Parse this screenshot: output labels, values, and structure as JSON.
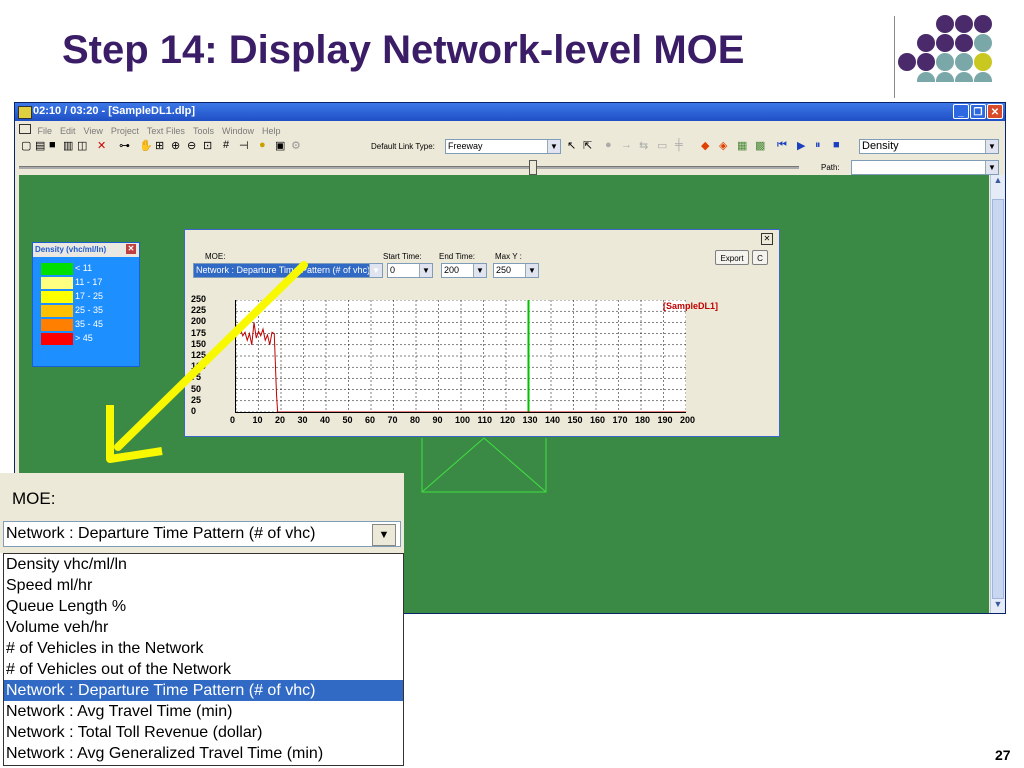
{
  "slide": {
    "title": "Step 14: Display Network-level MOE",
    "page_number": "27",
    "dot_colors": [
      "#4a2a6a",
      "#7aa7a7",
      "#c8c820"
    ]
  },
  "window": {
    "title": "02:10 / 03:20 - [SampleDL1.dlp]",
    "menu": [
      "File",
      "Edit",
      "View",
      "Project",
      "Text Files",
      "Tools",
      "Window",
      "Help"
    ],
    "link_type_label": "Default Link Type:",
    "link_type_value": "Freeway",
    "moe_view_value": "Density",
    "path_label": "Path:",
    "path_value": ""
  },
  "legend": {
    "title": "Density (vhc/ml/ln)",
    "items": [
      {
        "label": "< 11",
        "color": "#00e000"
      },
      {
        "label": "11 - 17",
        "color": "#ffff80"
      },
      {
        "label": "17 - 25",
        "color": "#ffff00"
      },
      {
        "label": "25 - 35",
        "color": "#ffc000"
      },
      {
        "label": "35 - 45",
        "color": "#ff8000"
      },
      {
        "label": "> 45",
        "color": "#ff0000"
      }
    ]
  },
  "moe_dialog": {
    "moe_label": "MOE:",
    "moe_value": "Network : Departure Time Pattern (# of vhc)",
    "start_time_label": "Start Time:",
    "start_time_value": "0",
    "end_time_label": "End Time:",
    "end_time_value": "200",
    "max_y_label": "Max Y :",
    "max_y_value": "250",
    "export_label": "Export",
    "c_label": "C",
    "close_glyph": "✕"
  },
  "chart_data": {
    "type": "line",
    "series": [
      {
        "name": "[SampleDL1]",
        "color": "#c00000",
        "x": [
          0,
          1,
          2,
          3,
          4,
          5,
          6,
          7,
          8,
          9,
          10,
          11,
          12,
          13,
          14,
          15,
          16,
          17,
          18,
          18.5,
          19,
          20,
          200
        ],
        "values": [
          190,
          180,
          185,
          170,
          178,
          160,
          175,
          150,
          200,
          165,
          180,
          170,
          185,
          160,
          172,
          150,
          178,
          175,
          40,
          0,
          0,
          0,
          0
        ]
      }
    ],
    "marker_x": 130,
    "marker_color": "#00c000",
    "xlim": [
      0,
      200
    ],
    "ylim": [
      0,
      250
    ],
    "x_ticks": [
      "0",
      "10",
      "20",
      "30",
      "40",
      "50",
      "60",
      "70",
      "80",
      "90",
      "100",
      "110",
      "120",
      "130",
      "140",
      "150",
      "160",
      "170",
      "180",
      "190",
      "200"
    ],
    "y_ticks": [
      "0",
      "25",
      "50",
      "75",
      "100",
      "125",
      "150",
      "175",
      "200",
      "225",
      "250"
    ],
    "grid": true,
    "legend_position": "top-right"
  },
  "zoom": {
    "moe_label": "MOE:",
    "selected_value": "Network : Departure Time Pattern (# of vhc)",
    "options": [
      "Density  vhc/ml/ln",
      "Speed  ml/hr",
      "Queue Length %",
      "Volume veh/hr",
      "# of Vehicles in the Network",
      "# of Vehicles out of the Network",
      "Network : Departure Time Pattern (# of vhc)",
      "Network : Avg Travel Time (min)",
      "Network : Total Toll Revenue (dollar)",
      "Network : Avg Generalized Travel Time (min)"
    ],
    "selected_index": 6
  }
}
